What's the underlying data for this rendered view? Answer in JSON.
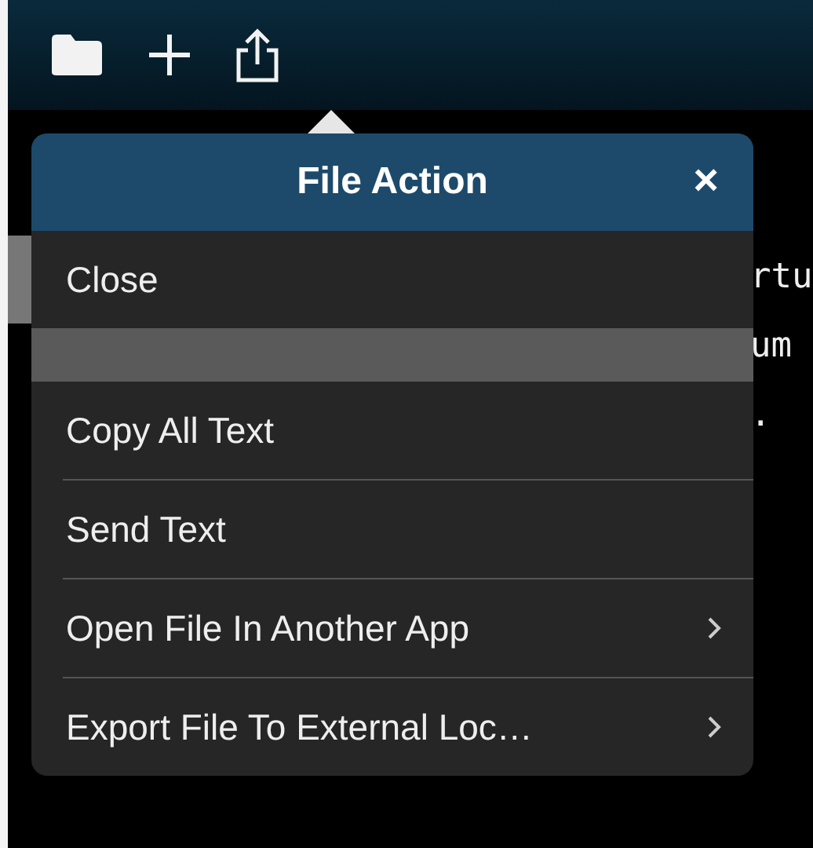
{
  "toolbar": {
    "buttons": [
      {
        "kind": "folder"
      },
      {
        "kind": "add"
      },
      {
        "kind": "share"
      }
    ]
  },
  "background_text": [
    "rtu",
    "um",
    "."
  ],
  "popover": {
    "title": "File Action",
    "close": "×",
    "items": [
      {
        "kind": "action",
        "label": "Close"
      },
      {
        "kind": "spacer"
      },
      {
        "kind": "action",
        "label": "Copy All Text"
      },
      {
        "kind": "action",
        "label": "Send Text"
      },
      {
        "kind": "submenu",
        "label": "Open File In Another App"
      },
      {
        "kind": "submenu",
        "label": "Export File To External Loc…"
      }
    ]
  }
}
